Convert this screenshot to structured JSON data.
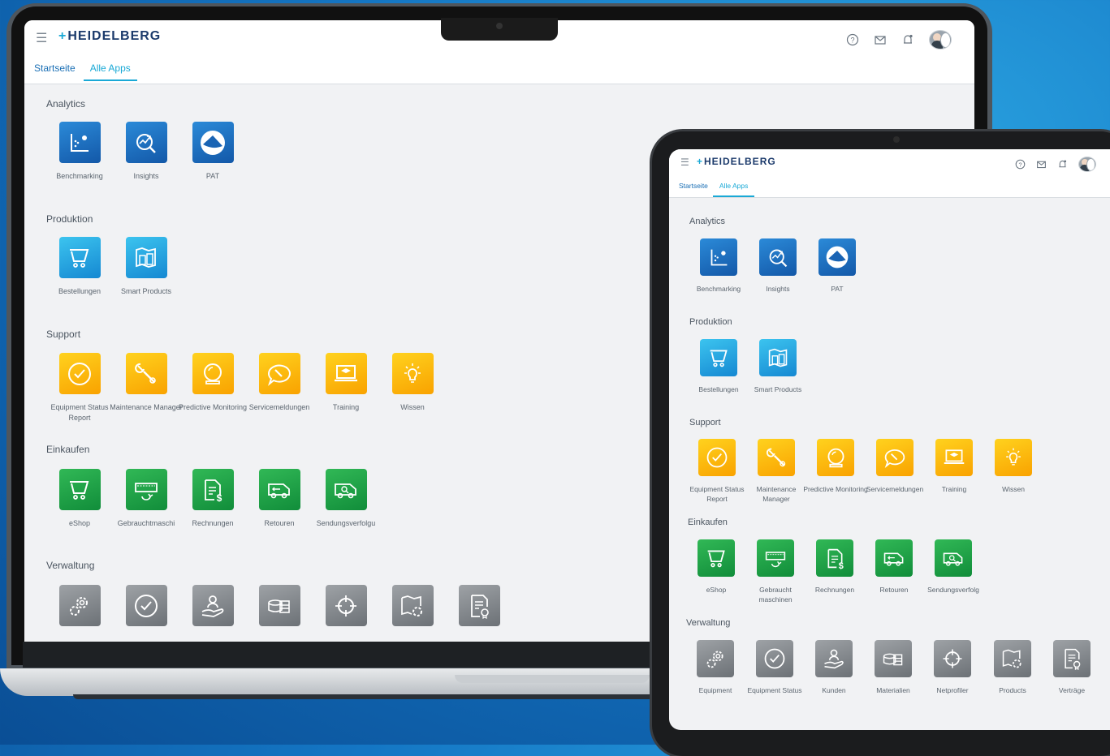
{
  "brand": {
    "logo_text": "HEIDELBERG",
    "accent": "#1aa9d6",
    "navy": "#1b3a6b"
  },
  "header": {
    "icons": [
      "help-icon",
      "mail-icon",
      "notification-bell-icon",
      "avatar"
    ]
  },
  "tabs": [
    {
      "label": "Startseite",
      "active": false
    },
    {
      "label": "Alle Apps",
      "active": true
    }
  ],
  "laptop": {
    "sections": {
      "analytics": "Analytics",
      "produktion": "Produktion",
      "support": "Support",
      "einkaufen": "Einkaufen",
      "verwaltung": "Verwaltung"
    },
    "analytics": [
      "Benchmarking",
      "Insights",
      "PAT"
    ],
    "produktion": [
      "Bestellungen",
      "Smart Products"
    ],
    "support": [
      "Equipment Status Report",
      "Maintenance Manager",
      "Predictive Monitoring",
      "Servicemeldungen",
      "Training",
      "Wissen"
    ],
    "einkaufen": [
      "eShop",
      "Gebrauchtmaschi",
      "Rechnungen",
      "Retouren",
      "Sendungsverfolgu"
    ]
  },
  "tablet": {
    "sections": {
      "analytics": "Analytics",
      "produktion": "Produktion",
      "support": "Support",
      "einkaufen": "Einkaufen",
      "verwaltung": "Verwaltung"
    },
    "analytics": [
      "Benchmarking",
      "Insights",
      "PAT"
    ],
    "produktion": [
      "Bestellungen",
      "Smart Products"
    ],
    "support": [
      "Equipment Status Report",
      "Maintenance Manager",
      "Predictive Monitoring",
      "Servicemeldungen",
      "Training",
      "Wissen"
    ],
    "einkaufen": [
      "eShop",
      "Gebraucht maschinen",
      "Rechnungen",
      "Retouren",
      "Sendungsverfolg"
    ],
    "verwaltung": [
      "Equipment",
      "Equipment Status",
      "Kunden",
      "Materialien",
      "Netprofiler",
      "Products",
      "Verträge"
    ]
  }
}
